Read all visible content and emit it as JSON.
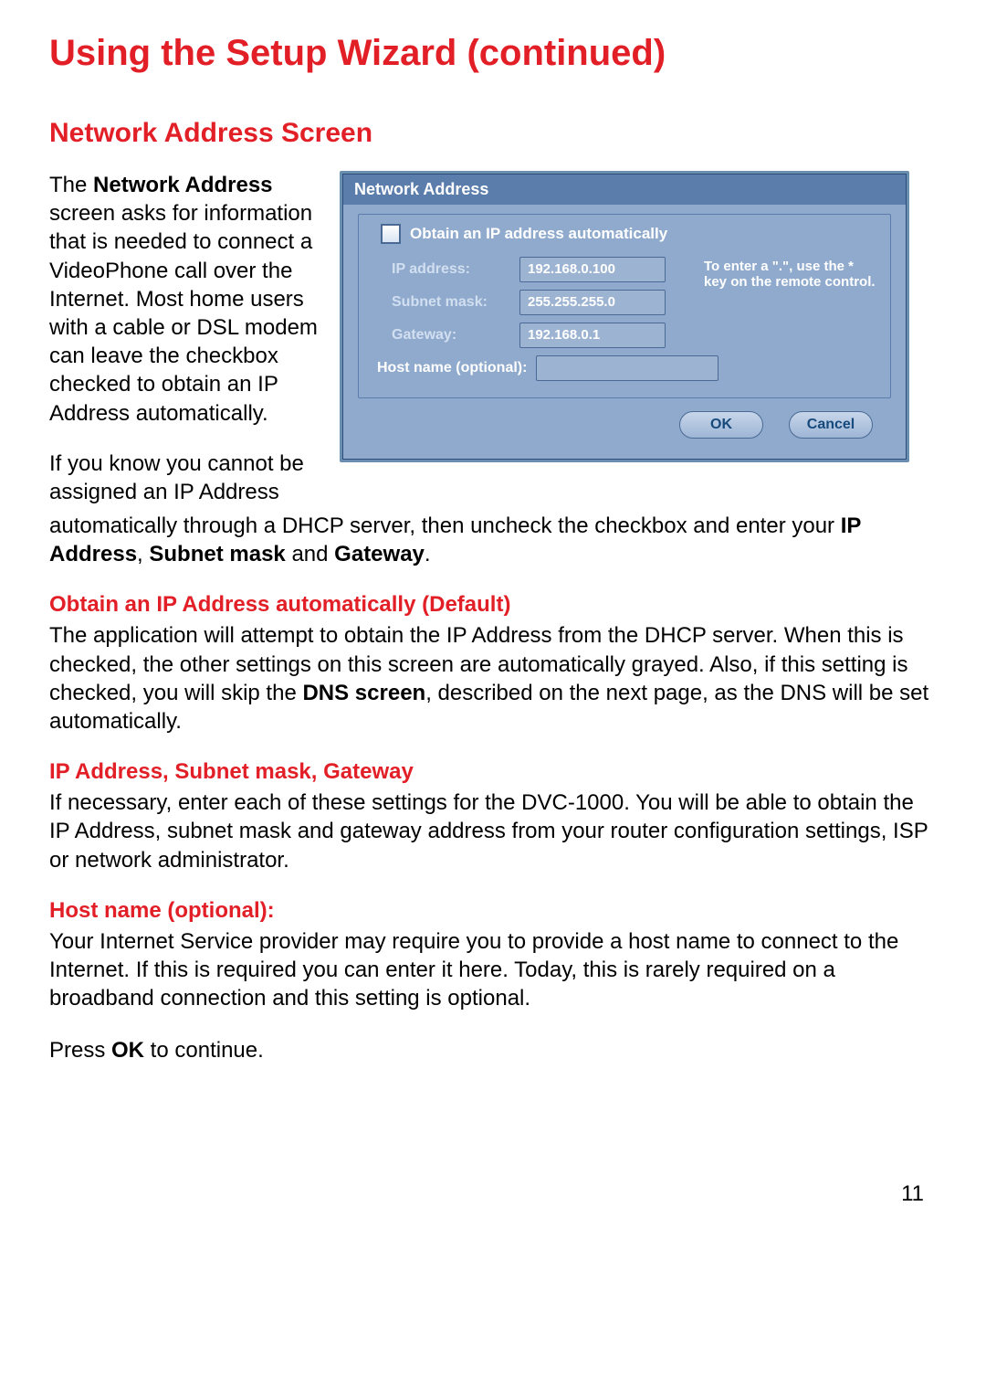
{
  "page": {
    "title": "Using the Setup Wizard (continued)",
    "sectionHeading": "Network Address Screen",
    "pageNumber": "11"
  },
  "intro": {
    "p1_prefix": "The ",
    "p1_bold": "Network Address",
    "p1_rest": " screen asks for information that is needed to connect a VideoPhone call over the Internet. Most home users with a cable or DSL modem can leave the checkbox checked to obtain an IP Address automatically.",
    "p2_part1": "If you know you cannot be assigned an IP Address",
    "p2_part2a": "automatically through a DHCP server, then uncheck the checkbox and enter your ",
    "p2_b1": "IP Address",
    "p2_sep1": ", ",
    "p2_b2": "Subnet mask",
    "p2_sep2": " and ",
    "p2_b3": "Gateway",
    "p2_end": "."
  },
  "sections": {
    "obtain": {
      "heading": "Obtain an IP Address automatically (Default)",
      "text_a": "The application will attempt to obtain the IP Address from the DHCP server. When this is checked, the other settings on this screen are automatically grayed. Also, if this setting is checked, you will skip the ",
      "text_bold": "DNS screen",
      "text_b": ", described on the next page, as the DNS will be set automatically."
    },
    "ipsg": {
      "heading": "IP Address, Subnet mask, Gateway",
      "text": "If necessary, enter each of these settings for the DVC-1000. You will be able to obtain the IP Address, subnet mask and gateway address from your router configuration settings, ISP or network administrator."
    },
    "host": {
      "heading": "Host name (optional):",
      "text": "Your Internet Service provider may require you to provide a host name to connect to the Internet. If this is required you can enter it here.  Today, this is rarely required on a broadband connection and this setting is optional."
    },
    "press": {
      "text_a": "Press ",
      "text_bold": "OK",
      "text_b": " to continue."
    }
  },
  "dialog": {
    "title": "Network Address",
    "checkboxLabel": "Obtain an IP address automatically",
    "fields": {
      "ipLabel": "IP address:",
      "ipValue": "192.168.0.100",
      "maskLabel": "Subnet mask:",
      "maskValue": "255.255.255.0",
      "gwLabel": "Gateway:",
      "gwValue": "192.168.0.1",
      "hostLabel": "Host name (optional):",
      "hostValue": ""
    },
    "hint": "To enter a \".\", use the * key on the remote control.",
    "buttons": {
      "ok": "OK",
      "cancel": "Cancel"
    }
  }
}
